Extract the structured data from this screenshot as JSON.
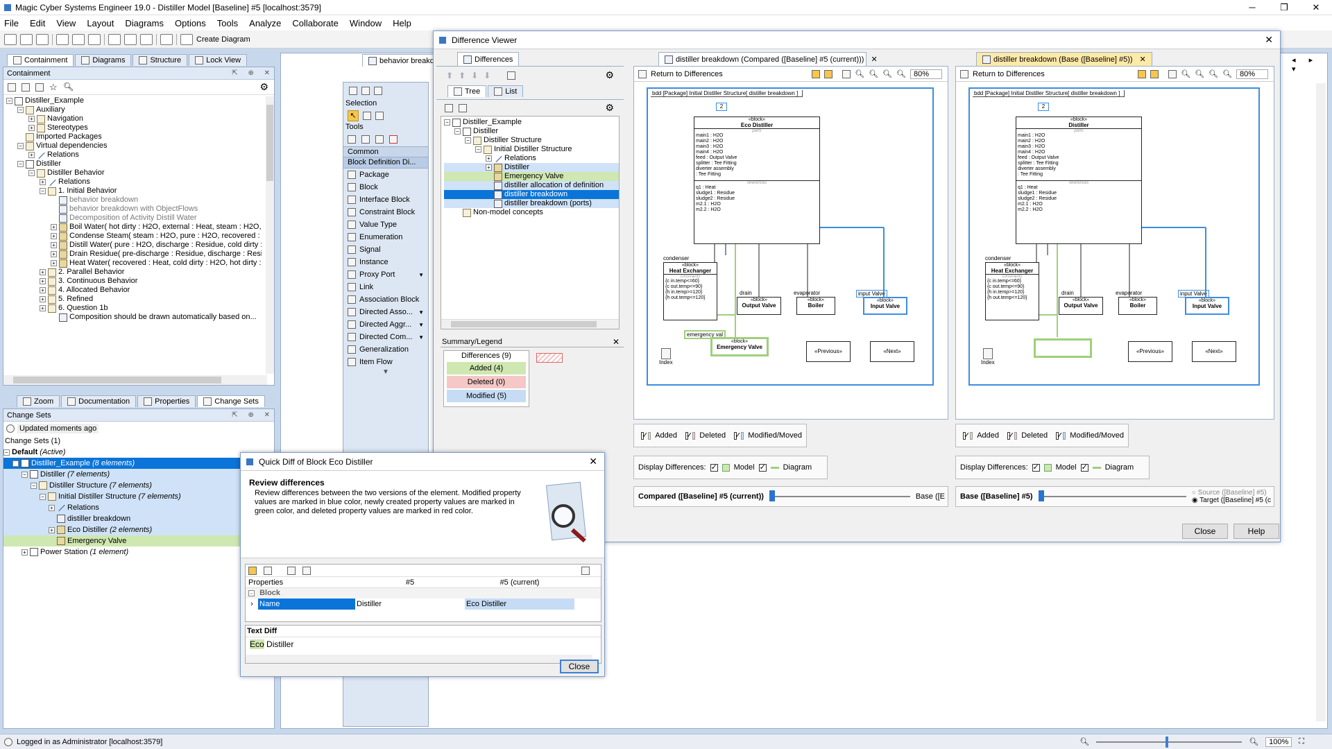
{
  "app": {
    "title": "Magic Cyber Systems Engineer 19.0 - Distiller Model [Baseline] #5 [localhost:3579]"
  },
  "menu": [
    "File",
    "Edit",
    "View",
    "Layout",
    "Diagrams",
    "Options",
    "Tools",
    "Analyze",
    "Collaborate",
    "Window",
    "Help"
  ],
  "toolbar": {
    "create_diagram": "Create Diagram"
  },
  "nav_tabs": [
    "Containment",
    "Diagrams",
    "Structure",
    "Lock View"
  ],
  "containment": {
    "title": "Containment",
    "tree": [
      {
        "label": "Distiller_Example",
        "indent": 0,
        "exp": "-",
        "icon": "pkg"
      },
      {
        "label": "Auxiliary",
        "indent": 1,
        "exp": "-",
        "icon": "folder"
      },
      {
        "label": "Navigation",
        "indent": 2,
        "exp": "+",
        "icon": "folder"
      },
      {
        "label": "Stereotypes",
        "indent": 2,
        "exp": "+",
        "icon": "folder"
      },
      {
        "label": "Imported Packages",
        "indent": 1,
        "exp": "",
        "icon": "folder"
      },
      {
        "label": "Virtual dependencies",
        "indent": 1,
        "exp": "-",
        "icon": "folder"
      },
      {
        "label": "Relations",
        "indent": 2,
        "exp": "+",
        "icon": "rel"
      },
      {
        "label": "Distiller",
        "indent": 1,
        "exp": "-",
        "icon": "pkg"
      },
      {
        "label": "Distiller Behavior",
        "indent": 2,
        "exp": "-",
        "icon": "folder"
      },
      {
        "label": "Relations",
        "indent": 3,
        "exp": "+",
        "icon": "rel"
      },
      {
        "label": "1. Initial Behavior",
        "indent": 3,
        "exp": "-",
        "icon": "folder"
      },
      {
        "label": "behavior breakdown",
        "indent": 4,
        "exp": "",
        "icon": "diag",
        "gray": true
      },
      {
        "label": "behavior breakdown with ObjectFlows",
        "indent": 4,
        "exp": "",
        "icon": "diag",
        "gray": true
      },
      {
        "label": "Decomposition of Activity Distill Water",
        "indent": 4,
        "exp": "",
        "icon": "diag",
        "gray": true
      },
      {
        "label": "Boil Water( hot dirty : H2O, external : Heat, steam : H2O, pre-discharge",
        "indent": 4,
        "exp": "+",
        "icon": "blk"
      },
      {
        "label": "Condense Steam( steam : H2O, pure : H2O, recovered : Heat )",
        "indent": 4,
        "exp": "+",
        "icon": "blk"
      },
      {
        "label": "Distill Water( pure : H2O, discharge : Residue, cold dirty : H2O, externa",
        "indent": 4,
        "exp": "+",
        "icon": "blk"
      },
      {
        "label": "Drain Residue( pre-discharge : Residue, discharge : Residue )",
        "indent": 4,
        "exp": "+",
        "icon": "blk"
      },
      {
        "label": "Heat Water( recovered : Heat, cold dirty : H2O, hot dirty : H2O )",
        "indent": 4,
        "exp": "+",
        "icon": "blk"
      },
      {
        "label": "2. Parallel Behavior",
        "indent": 3,
        "exp": "+",
        "icon": "folder"
      },
      {
        "label": "3. Continuous Behavior",
        "indent": 3,
        "exp": "+",
        "icon": "folder"
      },
      {
        "label": "4. Allocated Behavior",
        "indent": 3,
        "exp": "+",
        "icon": "folder"
      },
      {
        "label": "5. Refined",
        "indent": 3,
        "exp": "+",
        "icon": "folder"
      },
      {
        "label": "6. Question 1b",
        "indent": 3,
        "exp": "+",
        "icon": "folder"
      },
      {
        "label": "Composition should be drawn automatically based on...",
        "indent": 4,
        "exp": "",
        "icon": "diag"
      }
    ]
  },
  "bottom_tabs": [
    "Zoom",
    "Documentation",
    "Properties",
    "Change Sets"
  ],
  "change_sets": {
    "title": "Change Sets",
    "updated": "Updated moments ago",
    "count_label": "Change Sets (1)",
    "rows": [
      {
        "label": "Default",
        "suffix": "(Active)",
        "indent": 0,
        "exp": "-",
        "icon": "",
        "bold": true,
        "style": ""
      },
      {
        "label": "Distiller_Example",
        "suffix": "(8 elements)",
        "indent": 1,
        "exp": "-",
        "icon": "pkg",
        "style": "sel"
      },
      {
        "label": "Distiller",
        "suffix": "(7 elements)",
        "indent": 2,
        "exp": "-",
        "icon": "pkg",
        "style": "hl"
      },
      {
        "label": "Distiller Structure",
        "suffix": "(7 elements)",
        "indent": 3,
        "exp": "-",
        "icon": "folder",
        "style": "hl"
      },
      {
        "label": "Initial Distiller Structure",
        "suffix": "(7 elements)",
        "indent": 4,
        "exp": "-",
        "icon": "folder",
        "style": "hl"
      },
      {
        "label": "Relations",
        "suffix": "",
        "indent": 5,
        "exp": "+",
        "icon": "rel",
        "style": "hl"
      },
      {
        "label": "distiller breakdown",
        "suffix": "",
        "indent": 5,
        "exp": "",
        "icon": "diag",
        "style": "hl"
      },
      {
        "label": "Eco Distiller",
        "suffix": "(2 elements)",
        "indent": 5,
        "exp": "+",
        "icon": "blk",
        "style": "hl"
      },
      {
        "label": "Emergency Valve",
        "suffix": "",
        "indent": 5,
        "exp": "",
        "icon": "blk",
        "style": "green"
      },
      {
        "label": "Power Station",
        "suffix": "(1 element)",
        "indent": 2,
        "exp": "+",
        "icon": "pkg",
        "style": ""
      }
    ]
  },
  "diagram_tab": "behavior breakd",
  "palette": {
    "selection": "Selection",
    "tools": "Tools",
    "common": "Common",
    "bdd": "Block Definition Di...",
    "items": [
      "Package",
      "Block",
      "Interface Block",
      "Constraint Block",
      "Value Type",
      "Enumeration",
      "Signal",
      "Instance",
      "Proxy Port",
      "Link",
      "Association Block",
      "Directed Asso...",
      "Directed Aggr...",
      "Directed Com...",
      "Generalization",
      "Item Flow"
    ]
  },
  "status": {
    "login": "Logged in as Administrator [localhost:3579]",
    "zoom": "100%"
  },
  "diff_viewer": {
    "title": "Difference Viewer",
    "differences_tab": "Differences",
    "tree_tab": "Tree",
    "list_tab": "List",
    "tree": [
      {
        "label": "Distiller_Example",
        "indent": 0,
        "exp": "-",
        "icon": "pkg",
        "style": ""
      },
      {
        "label": "Distiller",
        "indent": 1,
        "exp": "-",
        "icon": "pkg",
        "style": ""
      },
      {
        "label": "Distiller Structure",
        "indent": 2,
        "exp": "-",
        "icon": "folder",
        "style": ""
      },
      {
        "label": "Initial Distiller Structure",
        "indent": 3,
        "exp": "-",
        "icon": "folder",
        "style": ""
      },
      {
        "label": "Relations",
        "indent": 4,
        "exp": "+",
        "icon": "rel",
        "style": ""
      },
      {
        "label": "Distiller",
        "indent": 4,
        "exp": "+",
        "icon": "blk",
        "style": "hl"
      },
      {
        "label": "Emergency Valve",
        "indent": 4,
        "exp": "",
        "icon": "blk",
        "style": "green"
      },
      {
        "label": "distiller allocation of definition",
        "indent": 4,
        "exp": "",
        "icon": "diag",
        "style": "hl"
      },
      {
        "label": "distiller breakdown",
        "indent": 4,
        "exp": "",
        "icon": "diag",
        "style": "sel"
      },
      {
        "label": "distiller breakdown (ports)",
        "indent": 4,
        "exp": "",
        "icon": "diag",
        "style": "hl"
      },
      {
        "label": "Non-model concepts",
        "indent": 1,
        "exp": "",
        "icon": "folder",
        "style": ""
      }
    ],
    "summary": {
      "title": "Summary/Legend",
      "differences": "Differences (9)",
      "added": "Added (4)",
      "deleted": "Deleted (0)",
      "modified": "Modified (5)"
    },
    "left": {
      "tab": "distiller breakdown (Compared ([Baseline] #5 (current)))",
      "return": "Return to Differences",
      "zoom": "80%",
      "diagram_title": "bdd [Package] Initial Distiller Structure[ distiller breakdown ]",
      "block_name": "Eco Distiller",
      "slider_label": "Compared ([Baseline] #5 (current))",
      "slider_right": "Base ([E"
    },
    "right": {
      "tab": "distiller breakdown (Base ([Baseline] #5))",
      "return": "Return to Differences",
      "zoom": "80%",
      "diagram_title": "bdd [Package] Initial Distiller Structure[ distiller breakdown ]",
      "block_name": "Distiller",
      "slider_label": "Base ([Baseline] #5)",
      "source": "Source ([Baseline] #5)",
      "target": "Target ([Baseline] #5 (c"
    },
    "diagram": {
      "block_stereo": "«block»",
      "parts_label": "parts",
      "parts": [
        "main1 : H2O",
        "main2 : H2O",
        "main3 : H2O",
        "main4 : H2O",
        "feed : Output Valve",
        "splitter : Tee Fitting",
        "diverter assembly",
        ": Tee Fitting"
      ],
      "refs_label": "references",
      "refs": [
        "q1 : Heat",
        "sludge1 : Residue",
        "sludge2 : Residue",
        "m2.1 : H2O",
        "m2.2 : H2O"
      ],
      "condenser": "condenser",
      "heat_exchanger": "Heat Exchanger",
      "constraints_label": "constraints",
      "constraints": [
        "{c in.temp<=60}",
        "{c out.temp<=90}",
        "{h in.temp>=120}",
        "{h out.temp<=120}"
      ],
      "drain": "drain",
      "output_valve": "Output Valve",
      "evaporator": "evaporator",
      "boiler": "Boiler",
      "input_valve_role": "input Valve",
      "input_valve": "Input Valve",
      "emergency_role": "emergency val",
      "emergency_valve": "Emergency Valve",
      "previous": "«Previous»",
      "next": "«Next»",
      "index": "Index",
      "mult": "2"
    },
    "legend": {
      "added": "Added",
      "deleted": "Deleted",
      "modified": "Modified/Moved"
    },
    "display": {
      "label": "Display Differences:",
      "model": "Model",
      "diagram": "Diagram"
    },
    "close": "Close",
    "help": "Help"
  },
  "quick_diff": {
    "title": "Quick Diff of Block Eco Distiller",
    "heading": "Review differences",
    "description": "Review differences between the two versions of the element. Modified property values are marked in blue color, newly created property values are marked in green color, and deleted property values are marked in red color.",
    "col_properties": "Properties",
    "col_v5": "#5",
    "col_current": "#5 (current)",
    "group": "Block",
    "row_name": "Name",
    "row_v5": "Distiller",
    "row_current": "Eco Distiller",
    "text_diff": "Text Diff",
    "added_text": "Eco",
    "base_text": " Distiller",
    "close": "Close"
  },
  "colors": {
    "added": "#cfe7b0",
    "deleted": "#f6c7c7",
    "modified": "#c6dcf5",
    "selected": "#0a74d8",
    "accent": "#3c8de0"
  }
}
